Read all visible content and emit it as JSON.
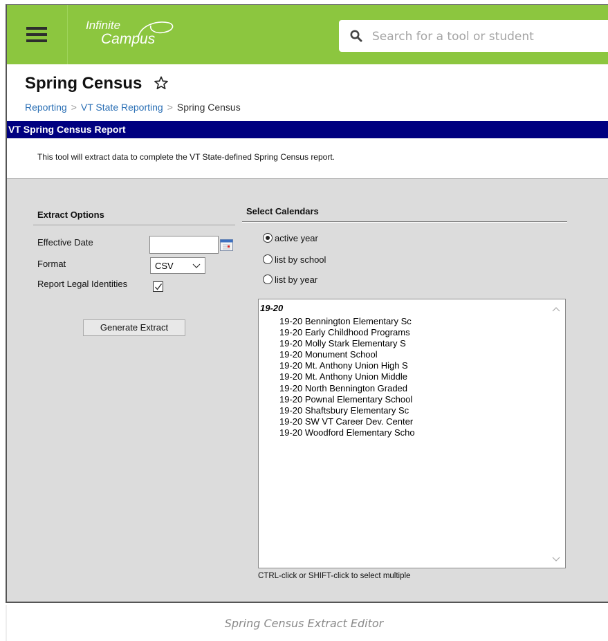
{
  "app": {
    "logo_line1": "Infinite",
    "logo_line2": "Campus",
    "search_placeholder": "Search for a tool or student"
  },
  "page": {
    "title": "Spring Census",
    "breadcrumb": [
      "Reporting",
      "VT State Reporting",
      "Spring Census"
    ]
  },
  "report": {
    "header": "VT Spring Census Report",
    "description": "This tool will extract data to complete the VT State-defined Spring Census report."
  },
  "extract_options": {
    "heading": "Extract Options",
    "effective_date_label": "Effective Date",
    "effective_date_value": "",
    "format_label": "Format",
    "format_value": "CSV",
    "legal_identities_label": "Report Legal Identities",
    "legal_identities_checked": true,
    "generate_label": "Generate Extract"
  },
  "calendars": {
    "heading": "Select Calendars",
    "radios": [
      {
        "label": "active year",
        "selected": true
      },
      {
        "label": "list by school",
        "selected": false
      },
      {
        "label": "list by year",
        "selected": false
      }
    ],
    "group": "19-20",
    "items": [
      "19-20 Bennington Elementary Sc",
      "19-20 Early Childhood Programs",
      "19-20 Molly Stark Elementary S",
      "19-20 Monument School",
      "19-20 Mt. Anthony Union High S",
      "19-20 Mt. Anthony Union Middle",
      "19-20 North Bennington Graded",
      "19-20 Pownal Elementary School",
      "19-20 Shaftsbury Elementary Sc",
      "19-20 SW VT Career Dev. Center",
      "19-20 Woodford Elementary Scho"
    ],
    "hint": "CTRL-click or SHIFT-click to select multiple"
  },
  "caption": "Spring Census Extract Editor",
  "colors": {
    "topbar": "#8cc63f",
    "report_header": "#000080",
    "link": "#2a6fb5"
  }
}
